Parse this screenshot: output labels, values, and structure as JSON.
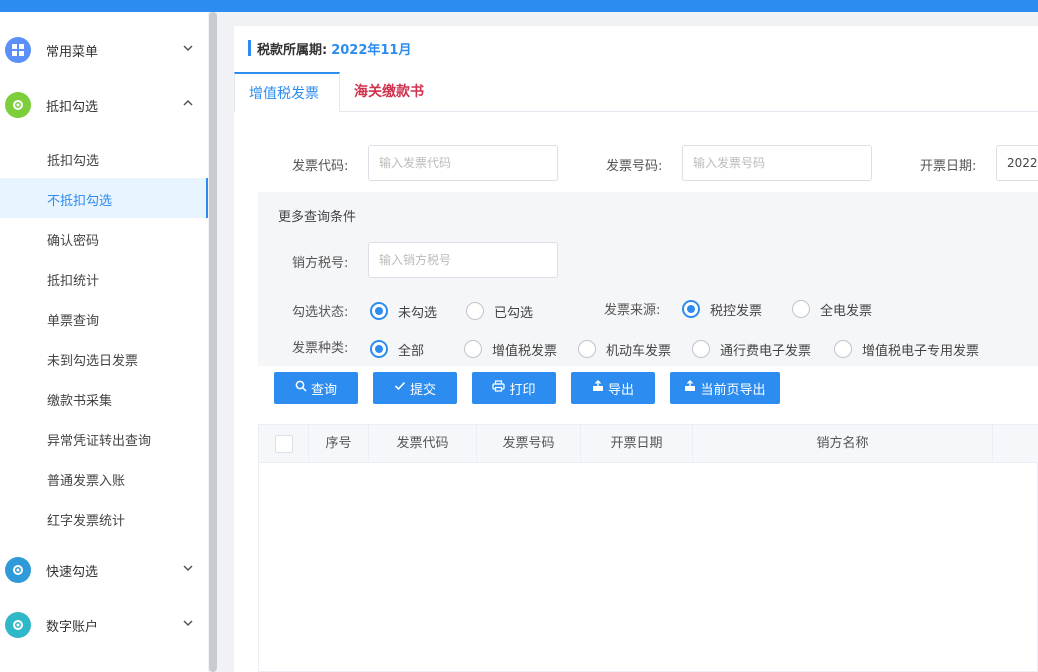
{
  "sidebar": {
    "groups": [
      {
        "label": "常用菜单",
        "icon": "menu-icon",
        "color": "#5b8ff9"
      },
      {
        "label": "抵扣勾选",
        "icon": "gear-icon",
        "color": "#7cce3a"
      },
      {
        "label": "快速勾选",
        "icon": "gear-icon",
        "color": "#2f9ad8"
      },
      {
        "label": "数字账户",
        "icon": "gear-icon",
        "color": "#2fb8c8"
      }
    ],
    "items": [
      "抵扣勾选",
      "不抵扣勾选",
      "确认密码",
      "抵扣统计",
      "单票查询",
      "未到勾选日发票",
      "缴款书采集",
      "异常凭证转出查询",
      "普通发票入账",
      "红字发票统计"
    ],
    "active_item": "不抵扣勾选"
  },
  "header": {
    "period_label": "税款所属期:",
    "period_value": "2022年11月"
  },
  "tabs": [
    {
      "label": "增值税发票",
      "active": true
    },
    {
      "label": "海关缴款书",
      "active": false
    }
  ],
  "search": {
    "code_label": "发票代码:",
    "code_placeholder": "输入发票代码",
    "number_label": "发票号码:",
    "number_placeholder": "输入发票号码",
    "date_label": "开票日期:",
    "date_value": "2022",
    "more_title": "更多查询条件",
    "seller_label": "销方税号:",
    "seller_placeholder": "输入销方税号",
    "status_label": "勾选状态:",
    "status_options": [
      "未勾选",
      "已勾选"
    ],
    "status_selected": "未勾选",
    "source_label": "发票来源:",
    "source_options": [
      "税控发票",
      "全电发票"
    ],
    "source_selected": "税控发票",
    "type_label": "发票种类:",
    "type_options": [
      "全部",
      "增值税发票",
      "机动车发票",
      "通行费电子发票",
      "增值税电子专用发票"
    ],
    "type_selected": "全部"
  },
  "buttons": {
    "query": "查询",
    "submit": "提交",
    "print": "打印",
    "export": "导出",
    "export_page": "当前页导出"
  },
  "table": {
    "columns": [
      "序号",
      "发票代码",
      "发票号码",
      "开票日期",
      "销方名称"
    ]
  },
  "colors": {
    "primary": "#2d8cf0",
    "tab_inactive": "#d0334f"
  }
}
